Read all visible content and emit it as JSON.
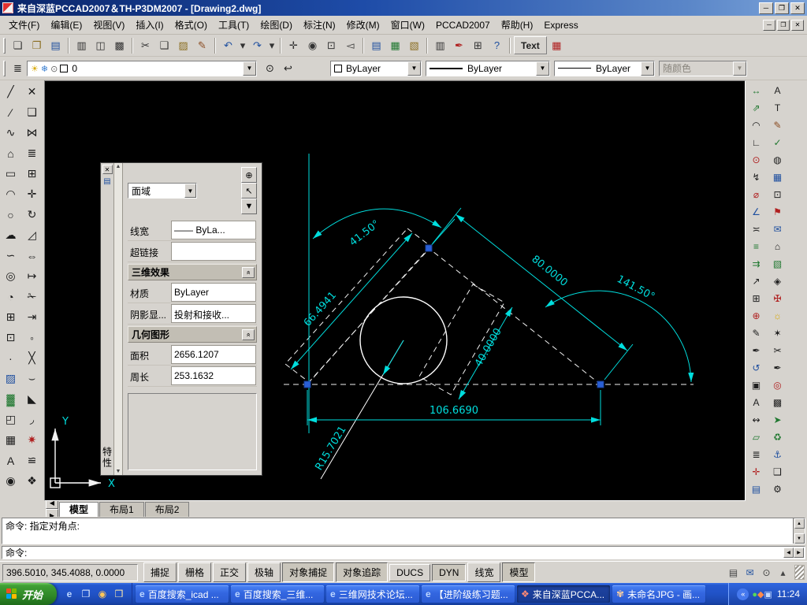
{
  "colors": {
    "canvas_bg": "#000000",
    "dimension_cyan": "#00dede",
    "geometry_white": "#f2f2f2",
    "grip_blue": "#2a5fd6",
    "titlebar_blue": "#1e4ca8",
    "taskbar_blue": "#2153c8",
    "start_green": "#2f8727"
  },
  "window": {
    "title": "来自深蓝PCCAD2007＆TH-P3DM2007 - [Drawing2.dwg]",
    "minimize": "─",
    "maximize": "❐",
    "close": "✕"
  },
  "mdi": {
    "minimize": "─",
    "restore": "❐",
    "close": "✕"
  },
  "menu": {
    "items": [
      {
        "label": "文件(F)"
      },
      {
        "label": "编辑(E)"
      },
      {
        "label": "视图(V)"
      },
      {
        "label": "插入(I)"
      },
      {
        "label": "格式(O)"
      },
      {
        "label": "工具(T)"
      },
      {
        "label": "绘图(D)"
      },
      {
        "label": "标注(N)"
      },
      {
        "label": "修改(M)"
      },
      {
        "label": "窗口(W)"
      },
      {
        "label": "PCCAD2007"
      },
      {
        "label": "帮助(H)"
      },
      {
        "label": "Express"
      }
    ]
  },
  "toolbar_standard": {
    "items": [
      {
        "name": "qnew-button",
        "glyph": "❏",
        "color": "#333333"
      },
      {
        "name": "open-button",
        "glyph": "❐",
        "color": "#8a6d1f"
      },
      {
        "name": "save-button",
        "glyph": "▤",
        "color": "#1f4f9f"
      },
      {
        "sep": true
      },
      {
        "name": "plot-button",
        "glyph": "▥",
        "color": "#333333"
      },
      {
        "name": "plot-preview-button",
        "glyph": "◫",
        "color": "#333333"
      },
      {
        "name": "publish-button",
        "glyph": "▩",
        "color": "#333333"
      },
      {
        "sep": true
      },
      {
        "name": "cut-button",
        "glyph": "✂",
        "color": "#333333"
      },
      {
        "name": "copy-button",
        "glyph": "❑",
        "color": "#333333"
      },
      {
        "name": "paste-button",
        "glyph": "▨",
        "color": "#8a6d1f"
      },
      {
        "name": "match-properties-button",
        "glyph": "✎",
        "color": "#8a4a1f"
      },
      {
        "sep": true
      },
      {
        "name": "undo-button",
        "glyph": "↶",
        "color": "#1f4f9f"
      },
      {
        "name": "undo-list-arrow",
        "glyph": "▾",
        "color": "#333333",
        "narrow": true
      },
      {
        "name": "redo-button",
        "glyph": "↷",
        "color": "#1f4f9f"
      },
      {
        "name": "redo-list-arrow",
        "glyph": "▾",
        "color": "#333333",
        "narrow": true
      },
      {
        "sep": true
      },
      {
        "name": "pan-button",
        "glyph": "✛",
        "color": "#333333"
      },
      {
        "name": "zoom-realtime-button",
        "glyph": "◉",
        "color": "#333333"
      },
      {
        "name": "zoom-window-button",
        "glyph": "⊡",
        "color": "#333333"
      },
      {
        "name": "zoom-previous-button",
        "glyph": "◅",
        "color": "#333333"
      },
      {
        "sep": true
      },
      {
        "name": "properties-button",
        "glyph": "▤",
        "color": "#1f4f9f"
      },
      {
        "name": "design-center-button",
        "glyph": "▦",
        "color": "#207830"
      },
      {
        "name": "tool-palettes-button",
        "glyph": "▧",
        "color": "#8a6d1f"
      },
      {
        "sep": true
      },
      {
        "name": "sheet-set-button",
        "glyph": "▥",
        "color": "#333333"
      },
      {
        "name": "markup-button",
        "glyph": "✒",
        "color": "#b02020"
      },
      {
        "name": "quick-calc-button",
        "glyph": "⊞",
        "color": "#333333"
      },
      {
        "name": "help-button",
        "glyph": "?",
        "color": "#1f4f9f"
      },
      {
        "sep": true
      },
      {
        "name": "text-tool-button",
        "label": "Text",
        "wide": true
      },
      {
        "name": "detail-table-button",
        "glyph": "▦",
        "color": "#b02020"
      }
    ]
  },
  "toolbar_properties": {
    "layer": "0",
    "color": "ByLayer",
    "linetype": "ByLayer",
    "lineweight": "ByLayer",
    "plot_style": "随颜色",
    "layer_icons": [
      {
        "name": "layer-on-bulb-icon",
        "glyph": "☀",
        "color": "#d8a800"
      },
      {
        "name": "layer-freeze-icon",
        "glyph": "❄",
        "color": "#3a7fd0"
      },
      {
        "name": "layer-lock-icon",
        "glyph": "⊙",
        "color": "#666666"
      }
    ]
  },
  "left_toolbar": {
    "draw": [
      {
        "name": "line-tool",
        "glyph": "╱"
      },
      {
        "name": "construction-line-tool",
        "glyph": "∕"
      },
      {
        "name": "polyline-tool",
        "glyph": "∿"
      },
      {
        "name": "polygon-tool",
        "glyph": "⌂"
      },
      {
        "name": "rectangle-tool",
        "glyph": "▭"
      },
      {
        "name": "arc-tool",
        "glyph": "◠"
      },
      {
        "name": "circle-tool",
        "glyph": "○"
      },
      {
        "name": "revision-cloud-tool",
        "glyph": "☁"
      },
      {
        "name": "spline-tool",
        "glyph": "∽"
      },
      {
        "name": "ellipse-tool",
        "glyph": "◎"
      },
      {
        "name": "ellipse-arc-tool",
        "glyph": "◔"
      },
      {
        "name": "insert-block-tool",
        "glyph": "⊞"
      },
      {
        "name": "make-block-tool",
        "glyph": "⊡"
      },
      {
        "name": "point-tool",
        "glyph": "∙"
      },
      {
        "name": "hatch-tool",
        "glyph": "▨",
        "color": "#1f4f9f"
      },
      {
        "name": "gradient-tool",
        "glyph": "▓",
        "color": "#207830"
      },
      {
        "name": "region-tool",
        "glyph": "◰"
      },
      {
        "name": "table-tool",
        "glyph": "▦"
      },
      {
        "name": "multiline-text-tool",
        "glyph": "A"
      },
      {
        "name": "donut-tool",
        "glyph": "◉"
      }
    ],
    "modify": [
      {
        "name": "erase-tool",
        "glyph": "✕"
      },
      {
        "name": "copy-object-tool",
        "glyph": "❑"
      },
      {
        "name": "mirror-tool",
        "glyph": "⋈"
      },
      {
        "name": "offset-tool",
        "glyph": "≣"
      },
      {
        "name": "array-tool",
        "glyph": "⊞"
      },
      {
        "name": "move-tool",
        "glyph": "✛"
      },
      {
        "name": "rotate-tool",
        "glyph": "↻"
      },
      {
        "name": "scale-tool",
        "glyph": "◿"
      },
      {
        "name": "stretch-tool",
        "glyph": "⇔"
      },
      {
        "name": "lengthen-tool",
        "glyph": "↦"
      },
      {
        "name": "trim-tool",
        "glyph": "✁"
      },
      {
        "name": "extend-tool",
        "glyph": "⇥"
      },
      {
        "name": "break-at-point-tool",
        "glyph": "◦"
      },
      {
        "name": "break-tool",
        "glyph": "╳"
      },
      {
        "name": "join-tool",
        "glyph": "⌣"
      },
      {
        "name": "chamfer-tool",
        "glyph": "◣"
      },
      {
        "name": "fillet-tool",
        "glyph": "◞"
      },
      {
        "name": "explode-tool",
        "glyph": "✷",
        "color": "#b02020"
      },
      {
        "name": "align-tool",
        "glyph": "≌"
      },
      {
        "name": "group-tool",
        "glyph": "❖"
      }
    ]
  },
  "right_toolbar": {
    "col1": [
      {
        "name": "dim-linear-tool",
        "glyph": "↔",
        "color": "#207830"
      },
      {
        "name": "dim-aligned-tool",
        "glyph": "⇗",
        "color": "#207830"
      },
      {
        "name": "dim-arc-length-tool",
        "glyph": "◠",
        "color": "#202020"
      },
      {
        "name": "dim-ordinate-tool",
        "glyph": "∟",
        "color": "#202020"
      },
      {
        "name": "dim-radius-tool",
        "glyph": "⊙",
        "color": "#b02020"
      },
      {
        "name": "dim-jogged-tool",
        "glyph": "↯",
        "color": "#202020"
      },
      {
        "name": "dim-diameter-tool",
        "glyph": "⌀",
        "color": "#b02020"
      },
      {
        "name": "dim-angular-tool",
        "glyph": "∠",
        "color": "#1f4f9f"
      },
      {
        "name": "quick-dim-tool",
        "glyph": "≍",
        "color": "#202020"
      },
      {
        "name": "dim-baseline-tool",
        "glyph": "≡",
        "color": "#207830"
      },
      {
        "name": "dim-continue-tool",
        "glyph": "⇉",
        "color": "#207830"
      },
      {
        "name": "quick-leader-tool",
        "glyph": "↗",
        "color": "#202020"
      },
      {
        "name": "tolerance-tool",
        "glyph": "⊞",
        "color": "#202020"
      },
      {
        "name": "center-mark-tool",
        "glyph": "⊕",
        "color": "#b02020"
      },
      {
        "name": "dim-edit-tool",
        "glyph": "✎",
        "color": "#202020"
      },
      {
        "name": "dim-text-edit-tool",
        "glyph": "✒",
        "color": "#202020"
      },
      {
        "name": "dim-update-tool",
        "glyph": "↺",
        "color": "#1f4f9f"
      },
      {
        "name": "dim-style-tool",
        "glyph": "▣",
        "color": "#202020"
      },
      {
        "name": "text-style-tool",
        "glyph": "A",
        "color": "#202020"
      },
      {
        "name": "distance-tool",
        "glyph": "↭",
        "color": "#202020"
      },
      {
        "name": "area-tool",
        "glyph": "▱",
        "color": "#207830"
      },
      {
        "name": "list-tool",
        "glyph": "≣",
        "color": "#202020"
      },
      {
        "name": "locate-point-tool",
        "glyph": "✛",
        "color": "#b02020"
      },
      {
        "name": "object-properties-tool",
        "glyph": "▤",
        "color": "#1f4f9f"
      }
    ],
    "col2": [
      {
        "name": "mtext-tool",
        "glyph": "A",
        "color": "#202020"
      },
      {
        "name": "single-text-tool",
        "glyph": "T",
        "color": "#202020"
      },
      {
        "name": "edit-text-tool",
        "glyph": "✎",
        "color": "#8a4a1f"
      },
      {
        "name": "spell-check-tool",
        "glyph": "✓",
        "color": "#207830"
      },
      {
        "name": "find-tool",
        "glyph": "◍",
        "color": "#202020"
      },
      {
        "name": "table-insert-tool",
        "glyph": "▦",
        "color": "#1f4f9f"
      },
      {
        "name": "block-editor-tool",
        "glyph": "⊡",
        "color": "#202020"
      },
      {
        "name": "flag-tool",
        "glyph": "⚑",
        "color": "#b02020"
      },
      {
        "name": "etransmit-tool",
        "glyph": "✉",
        "color": "#1f4f9f"
      },
      {
        "name": "home-view-tool",
        "glyph": "⌂",
        "color": "#202020"
      },
      {
        "name": "hatch-edit-tool",
        "glyph": "▧",
        "color": "#207830"
      },
      {
        "name": "block-attr-tool",
        "glyph": "◈",
        "color": "#202020"
      },
      {
        "name": "axis-tool",
        "glyph": "✠",
        "color": "#b02020"
      },
      {
        "name": "render-tool",
        "glyph": "☼",
        "color": "#d8a800"
      },
      {
        "name": "star-tool",
        "glyph": "✶",
        "color": "#202020"
      },
      {
        "name": "clip-tool",
        "glyph": "✂",
        "color": "#202020"
      },
      {
        "name": "pen-tool",
        "glyph": "✒",
        "color": "#202020"
      },
      {
        "name": "target-tool",
        "glyph": "◎",
        "color": "#b02020"
      },
      {
        "name": "grid-tool",
        "glyph": "▩",
        "color": "#202020"
      },
      {
        "name": "arrow-tool",
        "glyph": "➤",
        "color": "#207830"
      },
      {
        "name": "recycle-tool",
        "glyph": "♻",
        "color": "#207830"
      },
      {
        "name": "anchor-tool",
        "glyph": "⚓",
        "color": "#1f4f9f"
      },
      {
        "name": "note-tool",
        "glyph": "❑",
        "color": "#202020"
      },
      {
        "name": "settings-tool",
        "glyph": "⚙",
        "color": "#202020"
      }
    ]
  },
  "palette": {
    "title": "特性",
    "close": "✕",
    "icon": "▤",
    "selector": "面域",
    "scroll_up": "▲",
    "scroll_down": "▼",
    "buttons": [
      {
        "name": "toggle-pickadd-button",
        "glyph": "⊕"
      },
      {
        "name": "select-objects-button",
        "glyph": "↖"
      },
      {
        "name": "quick-select-button",
        "glyph": "▼"
      }
    ],
    "rows": [
      {
        "label": "线宽",
        "value": "—— ByLa..."
      },
      {
        "label": "超链接",
        "value": ""
      },
      {
        "header": true,
        "label": "三维效果",
        "chevron": "»"
      },
      {
        "label": "材质",
        "value": "ByLayer"
      },
      {
        "label": "阴影显...",
        "value": "投射和接收..."
      },
      {
        "header": true,
        "label": "几何图形",
        "chevron": "»"
      },
      {
        "label": "面积",
        "value": "2656.1207"
      },
      {
        "label": "周长",
        "value": "253.1632"
      }
    ]
  },
  "drawing": {
    "dim_angle_top": "41.50°",
    "dim_left": "66.4941",
    "dim_right": "80.0000",
    "dim_angle_right": "141.50°",
    "dim_width": "40.0000",
    "dim_bottom": "106.6690",
    "dim_radius": "R15.7021",
    "ucs_x": "X",
    "ucs_y": "Y"
  },
  "tabs": {
    "nav": [
      "«",
      "◀",
      "▶",
      "»"
    ],
    "items": [
      {
        "label": "模型",
        "active": true
      },
      {
        "label": "布局1"
      },
      {
        "label": "布局2"
      }
    ]
  },
  "command": {
    "history": [
      {
        "text": "命令: 指定对角点:"
      },
      {
        "text": ""
      }
    ],
    "prompt": "命令:",
    "scroll_up": "▲",
    "scroll_down": "▼",
    "scroll_left": "◀",
    "scroll_right": "▶"
  },
  "status": {
    "coords": "396.5010, 345.4088, 0.0000",
    "toggles": [
      {
        "label": "捕捉",
        "active": false
      },
      {
        "label": "栅格",
        "active": false
      },
      {
        "label": "正交",
        "active": false
      },
      {
        "label": "极轴",
        "active": false
      },
      {
        "label": "对象捕捉",
        "active": true
      },
      {
        "label": "对象追踪",
        "active": true
      },
      {
        "label": "DUCS",
        "active": false
      },
      {
        "label": "DYN",
        "active": true
      },
      {
        "label": "线宽",
        "active": false
      },
      {
        "label": "模型",
        "active": true
      }
    ],
    "tray_icons": [
      {
        "name": "plot-notify-icon",
        "glyph": "▤",
        "color": "#444444"
      },
      {
        "name": "communication-center-icon",
        "glyph": "✉",
        "color": "#1f4f9f"
      },
      {
        "name": "toolbar-lock-icon",
        "glyph": "⊙",
        "color": "#444444"
      },
      {
        "name": "tray-arrow-icon",
        "glyph": "▴",
        "color": "#444444"
      }
    ]
  },
  "taskbar": {
    "start_label": "开始",
    "quick_launch": [
      {
        "name": "ie-quicklaunch-icon",
        "glyph": "e",
        "color": "#bcd6ff"
      },
      {
        "name": "show-desktop-icon",
        "glyph": "❐",
        "color": "#e8f0ff"
      },
      {
        "name": "media-player-icon",
        "glyph": "◉",
        "color": "#ffc65a"
      },
      {
        "name": "folder-quicklaunch-icon",
        "glyph": "❒",
        "color": "#ffe9a8"
      }
    ],
    "tasks": [
      {
        "name": "task-baidu-icad",
        "icon": "e",
        "icon_color": "#bcd6ff",
        "label": "百度搜索_icad ...",
        "active": false
      },
      {
        "name": "task-baidu-sanwei",
        "icon": "e",
        "icon_color": "#bcd6ff",
        "label": "百度搜索_三维...",
        "active": false
      },
      {
        "name": "task-3d-forum",
        "icon": "e",
        "icon_color": "#bcd6ff",
        "label": "三维网技术论坛...",
        "active": false
      },
      {
        "name": "task-practice-doc",
        "icon": "e",
        "icon_color": "#bcd6ff",
        "label": "【进阶级练习题...",
        "active": false
      },
      {
        "name": "task-pccad",
        "icon": "❖",
        "icon_color": "#ff8a76",
        "label": "来自深蓝PCCA...",
        "active": true
      },
      {
        "name": "task-paint-jpg",
        "icon": "✾",
        "icon_color": "#ffd0a0",
        "label": "未命名JPG - 画...",
        "active": false
      }
    ],
    "tray_chevron": "«",
    "tray_icons": [
      {
        "name": "tray-antivirus-icon",
        "glyph": "●",
        "color": "#58d858"
      },
      {
        "name": "tray-usb-icon",
        "glyph": "◆",
        "color": "#ff8a4a"
      },
      {
        "name": "tray-display-icon",
        "glyph": "▣",
        "color": "#c0d8ff"
      }
    ],
    "time": "11:24"
  }
}
